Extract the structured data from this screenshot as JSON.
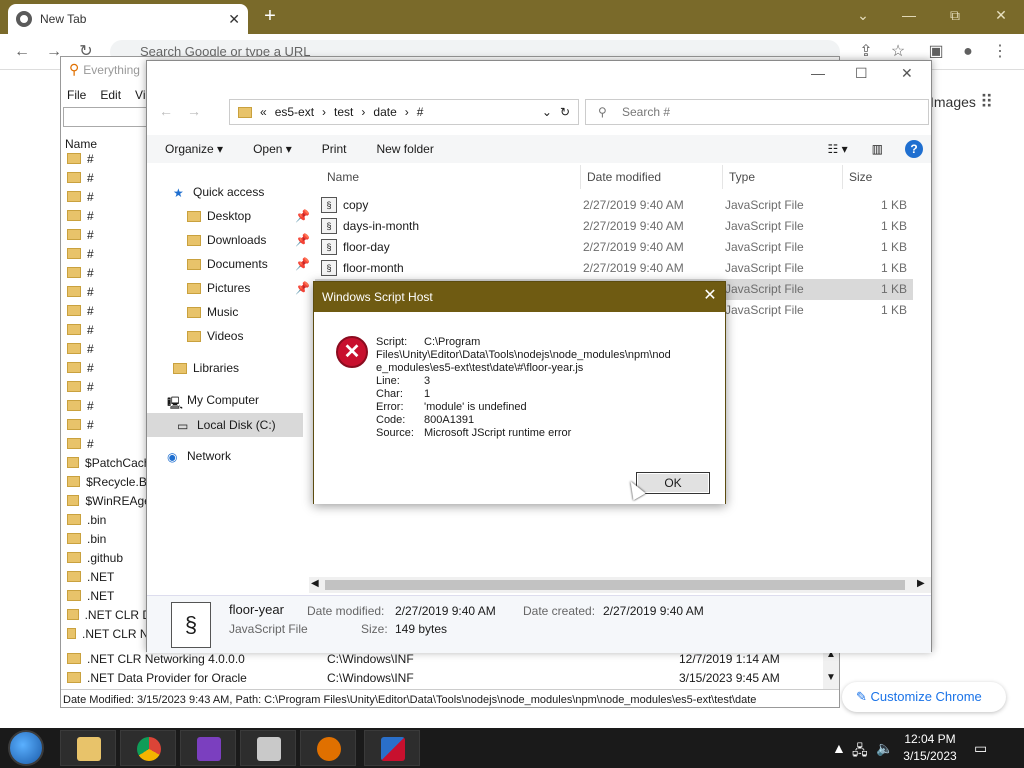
{
  "chrome": {
    "tab_title": "New Tab",
    "new_tab": "+",
    "omnibox_placeholder": "Search Google or type a URL",
    "images_link": "Images",
    "customize": "Customize Chrome",
    "minimize": "—",
    "restore": "⧉",
    "close": "✕"
  },
  "everything": {
    "title": "Everything",
    "menu": [
      "File",
      "Edit",
      "View"
    ],
    "col_name": "Name",
    "left_items": [
      "#",
      "#",
      "#",
      "#",
      "#",
      "#",
      "#",
      "#",
      "#",
      "#",
      "#",
      "#",
      "#",
      "#",
      "#",
      "#",
      "$PatchCache$",
      "$Recycle.Bin",
      "$WinREAgent",
      ".bin",
      ".bin",
      ".github",
      ".NET",
      ".NET",
      ".NET CLR Data",
      ".NET CLR Networking"
    ],
    "bottom_rows": [
      {
        "name": ".NET CLR Networking 4.0.0.0",
        "path": "C:\\Windows\\INF",
        "date": "12/7/2019 1:14 AM"
      },
      {
        "name": ".NET Data Provider for Oracle",
        "path": "C:\\Windows\\INF",
        "date": "3/15/2023 9:45 AM"
      }
    ],
    "status": "Date Modified: 3/15/2023 9:43 AM, Path: C:\\Program Files\\Unity\\Editor\\Data\\Tools\\nodejs\\node_modules\\npm\\node_modules\\es5-ext\\test\\date"
  },
  "explorer": {
    "address": [
      "es5-ext",
      "test",
      "date",
      "#"
    ],
    "search_placeholder": "Search #",
    "cmd": {
      "organize": "Organize ▾",
      "open": "Open ▾",
      "print": "Print",
      "new_folder": "New folder"
    },
    "nav": {
      "quick_access": "Quick access",
      "desktop": "Desktop",
      "downloads": "Downloads",
      "documents": "Documents",
      "pictures": "Pictures",
      "music": "Music",
      "videos": "Videos",
      "libraries": "Libraries",
      "my_computer": "My Computer",
      "local_disk": "Local Disk (C:)",
      "network": "Network"
    },
    "columns": {
      "name": "Name",
      "date": "Date modified",
      "type": "Type",
      "size": "Size"
    },
    "files": [
      {
        "name": "copy",
        "date": "2/27/2019 9:40 AM",
        "type": "JavaScript File",
        "size": "1 KB"
      },
      {
        "name": "days-in-month",
        "date": "2/27/2019 9:40 AM",
        "type": "JavaScript File",
        "size": "1 KB"
      },
      {
        "name": "floor-day",
        "date": "2/27/2019 9:40 AM",
        "type": "JavaScript File",
        "size": "1 KB"
      },
      {
        "name": "floor-month",
        "date": "2/27/2019 9:40 AM",
        "type": "JavaScript File",
        "size": "1 KB"
      },
      {
        "name": "",
        "date": "",
        "type": "JavaScript File",
        "size": "1 KB"
      },
      {
        "name": "",
        "date": "",
        "type": "JavaScript File",
        "size": "1 KB"
      }
    ],
    "details": {
      "name": "floor-year",
      "kind": "JavaScript File",
      "modified_label": "Date modified:",
      "modified": "2/27/2019 9:40 AM",
      "created_label": "Date created:",
      "created": "2/27/2019 9:40 AM",
      "size_label": "Size:",
      "size": "149 bytes"
    }
  },
  "dialog": {
    "title": "Windows Script Host",
    "script_label": "Script:",
    "script_line1": "C:\\Program",
    "script_line2": "Files\\Unity\\Editor\\Data\\Tools\\nodejs\\node_modules\\npm\\nod",
    "script_line3": "e_modules\\es5-ext\\test\\date\\#\\floor-year.js",
    "line_label": "Line:",
    "line": "3",
    "char_label": "Char:",
    "char": "1",
    "error_label": "Error:",
    "error": "'module' is undefined",
    "code_label": "Code:",
    "code": "800A1391",
    "source_label": "Source:",
    "source": "Microsoft JScript runtime error",
    "ok": "OK"
  },
  "taskbar": {
    "time": "12:04 PM",
    "date": "3/15/2023"
  },
  "colors": {
    "chrome_frame": "#7a6a2a",
    "dialog_title": "#6f5b12",
    "error_red": "#c8102e",
    "taskbar": "#1a1a1a"
  }
}
